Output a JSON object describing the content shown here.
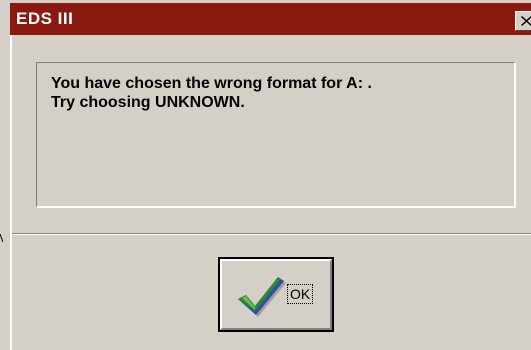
{
  "window": {
    "title": "EDS III",
    "close_icon": "close-x-icon"
  },
  "message": {
    "line1": "You have chosen the wrong format for A: .",
    "line2": "Try choosing UNKNOWN."
  },
  "buttons": {
    "ok_label": "OK",
    "ok_icon": "green-checkmark-icon"
  },
  "colors": {
    "titlebar": "#8a1a10",
    "dialog_face": "#d4d0c8",
    "checkmark_green": "#2f8a1f",
    "checkmark_blue": "#2a4fb0"
  }
}
